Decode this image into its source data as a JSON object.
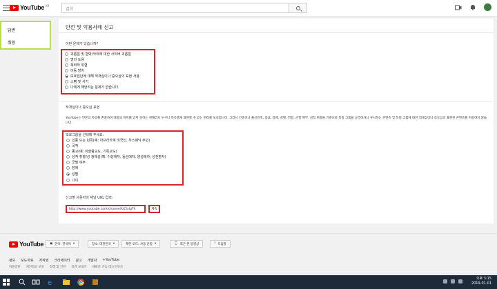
{
  "topbar": {
    "logo_text": "YouTube",
    "logo_region": "KR",
    "search_placeholder": "검색"
  },
  "sidebar": {
    "items": [
      "답변",
      "취향"
    ]
  },
  "card": {
    "title": "안전 및 악용사례 신고",
    "question": "어떤 문제가 있습니까?",
    "options": [
      {
        "label": "괴롭힘 및 협박/악의에 대한 사이버 괴롭힘",
        "selected": false
      },
      {
        "label": "명의 도용",
        "selected": false
      },
      {
        "label": "폭력적 위협",
        "selected": false
      },
      {
        "label": "아동 방치",
        "selected": false
      },
      {
        "label": "보호집단에 대해 적개심이나 증오심의 표현 사용",
        "selected": true
      },
      {
        "label": "스팸 및 사기",
        "selected": false
      },
      {
        "label": "나에게 해당하는 문제가 없습니다.",
        "selected": false
      }
    ],
    "section_title": "적개심이나 증오심 표현",
    "description": "YouTube는 언론의 자유를 존중하며 대중의 지지를 받지 못하는 견해라도 누구나 자유롭게 표현할 수 있는 권리를 보호합니다. 그러나 인종이나 출신민족, 종교, 장애, 성별, 연령, 군필 여부, 성적 취향을 기준으로 특정 그룹을 공격하거나 우시하는 콘텐츠 및 특정 그룹에 대한 적개심이나 증오심이 표현된 콘텐츠를 허용하지 않습니다.",
    "group_label": "보호그룹을 선택해 주세요:",
    "groups": [
      {
        "label": "인종 또는 민족(예: 아프리카계 미국인, 히스패닉 주민)",
        "selected": false
      },
      {
        "label": "국적",
        "selected": false
      },
      {
        "label": "종교(예: 이슬람교도, 기독교도)",
        "selected": false
      },
      {
        "label": "성적 취향/성 정체성(예: 이성애자, 동성애자, 양성애자, 성전환자)",
        "selected": false
      },
      {
        "label": "군필 여부",
        "selected": false
      },
      {
        "label": "장애",
        "selected": false
      },
      {
        "label": "성별",
        "selected": true
      },
      {
        "label": "나이",
        "selected": false
      }
    ],
    "url_label": "신고할 사용자의 채널 URL 입력:",
    "url_value": "http://www.youtube.com/channel/UCIxIgTh",
    "next_label": "계속"
  },
  "footer": {
    "logo_text": "YouTube",
    "pills": [
      "언어: 한국어",
      "장소: 대한민국",
      "제한 모드: 사용 안함",
      "최근 본 동영상",
      "도움말"
    ],
    "links": [
      "정보",
      "보도자료",
      "저작권",
      "크리에이터",
      "광고",
      "개발자",
      "+YouTube"
    ],
    "links2": [
      "이용약관",
      "개인정보 보호",
      "정책 및 안전",
      "의견 보내기",
      "새로운 기능 테스트하기"
    ]
  },
  "taskbar": {
    "time": "오후 3:15",
    "date": "2019-01-01"
  }
}
